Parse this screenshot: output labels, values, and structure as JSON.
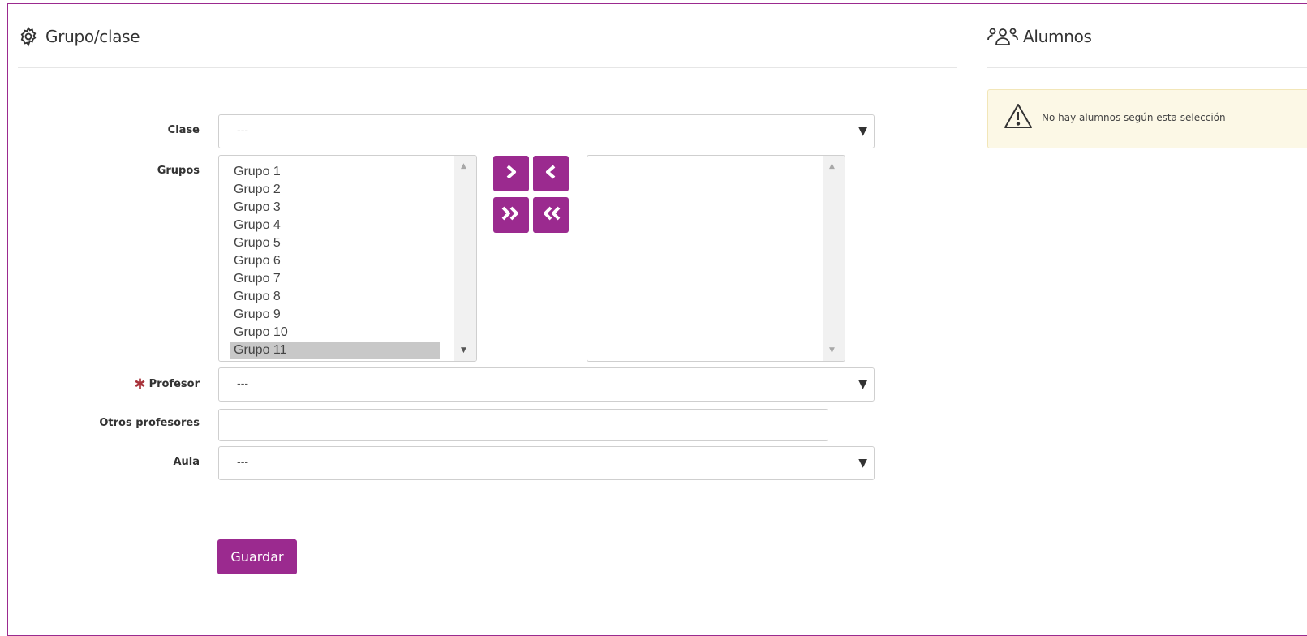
{
  "left_panel": {
    "icon": "gear-icon",
    "title": "Grupo/clase"
  },
  "right_panel": {
    "icon": "users-icon",
    "title": "Alumnos",
    "alert": {
      "icon": "warning-icon",
      "message": "No hay alumnos según esta selección"
    }
  },
  "form": {
    "clase": {
      "label": "Clase",
      "value": "---"
    },
    "grupos": {
      "label": "Grupos",
      "available": [
        "Grupo 1",
        "Grupo 2",
        "Grupo 3",
        "Grupo 4",
        "Grupo 5",
        "Grupo 6",
        "Grupo 7",
        "Grupo 8",
        "Grupo 9",
        "Grupo 10",
        "Grupo 11"
      ],
      "selected_option": "Grupo 11",
      "assigned": []
    },
    "transfer_buttons": {
      "move_right": "chevron-right-icon",
      "move_left": "chevron-left-icon",
      "move_all_right": "double-chevron-right-icon",
      "move_all_left": "double-chevron-left-icon"
    },
    "profesor": {
      "label": "Profesor",
      "required_mark": "✱",
      "value": "---"
    },
    "otros_profesores": {
      "label": "Otros profesores",
      "value": ""
    },
    "aula": {
      "label": "Aula",
      "value": "---"
    },
    "save_label": "Guardar"
  },
  "colors": {
    "accent": "#9b2a8f",
    "warning_bg": "#fcf8e6",
    "required": "#a8323a"
  }
}
